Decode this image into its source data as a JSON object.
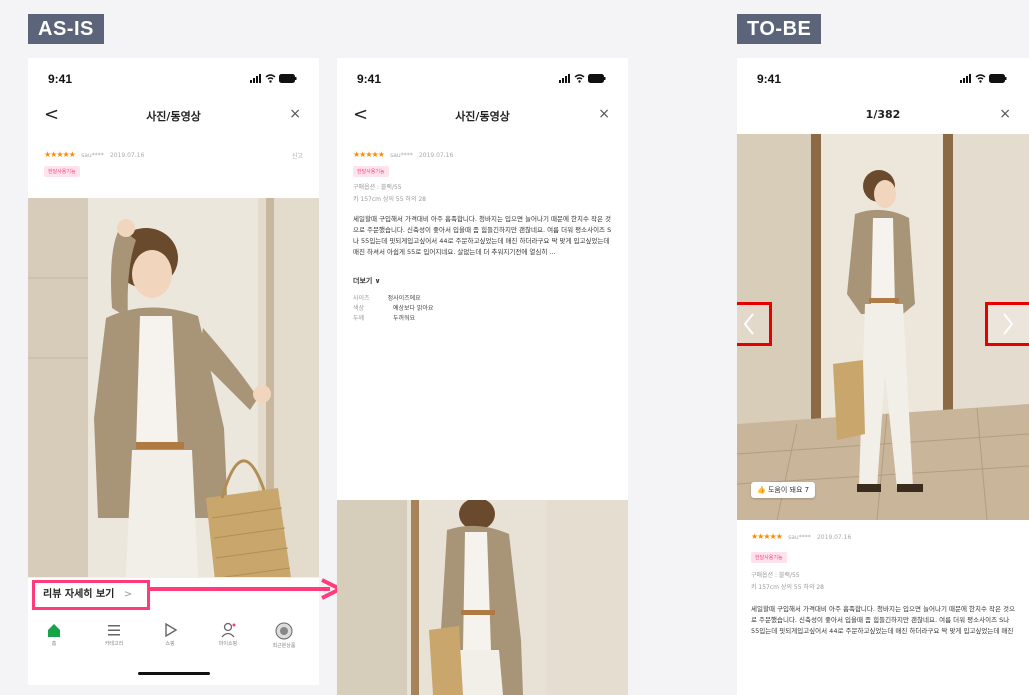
{
  "labels": {
    "asis": "AS-IS",
    "tobe": "TO-BE"
  },
  "status": {
    "time": "9:41"
  },
  "screen1": {
    "back": "<",
    "title": "사진/동영상",
    "close": "×",
    "stars": "★★★★★",
    "user": "sau****",
    "date": "2019.07.16",
    "report": "신고",
    "badge": "한달사용기능",
    "review_link": "리뷰 자세히 보기",
    "review_link_chevron": ">",
    "tabs": [
      "홈",
      "카테고리",
      "쇼핑",
      "마이쇼핑",
      "최근본상품"
    ]
  },
  "screen2": {
    "back": "<",
    "title": "사진/동영상",
    "close": "×",
    "stars": "★★★★★",
    "user": "sau****",
    "date": "2019.07.16",
    "badge": "한달사용기능",
    "option": "구매옵션 : 블랙/55",
    "size_info": "키 157cm  상의 55  하의 28",
    "body": "세일할때 구입해서 가격대비 아주 흡족합니다. 청바지는 입으면 늘어나기 때문에 한치수 작은 것으로 주문했습니다. 신축성이 좋아서 입을때 좀 힘들긴하지만 괜찮네요. 여름 더워 평소사이즈 S나 55입는데 핏되게입고싶어서 44로 주문하고싶었는데 매진 하더라구요 딱 맞게 입고싶었는데 매진 하셔서 아쉽게 55로 입어지네요. 살없는데 더 추워지기전에 열심히 ...",
    "more": "더보기 ∨",
    "attrs": [
      {
        "k": "사이즈",
        "v": "정사이즈에요"
      },
      {
        "k": "색상",
        "v": "예상보다 밝아요"
      },
      {
        "k": "두께",
        "v": "두꺼워요"
      }
    ]
  },
  "screen3": {
    "title": "1/382",
    "close": "×",
    "helpful": "도움이 돼요 7",
    "stars": "★★★★★",
    "user": "sau****",
    "date": "2019.07.16",
    "badge": "한달사용기능",
    "option": "구매옵션 : 블랙/55",
    "size_info": "키 157cm  상의 55  하의 28",
    "body": "세일할때 구입해서 가격대비 아주 흡족합니다. 청바지는 입으면 늘어나기 때문에 한치수 작은 것으로 주문했습니다. 신축성이 좋아서 입을때 좀 힘들긴하지만 괜찮네요. 여름 더워 평소사이즈 S나 55입는데 핏되게입고싶어서 44로 주문하고싶었는데 매진 하더라구요 딱 맞게 입고싶었는데 매진"
  },
  "colors": {
    "accent_pink": "#ff3b7a",
    "annotation_red": "#e60000",
    "tag_bg": "#5b6478",
    "star": "#ff8a00"
  }
}
